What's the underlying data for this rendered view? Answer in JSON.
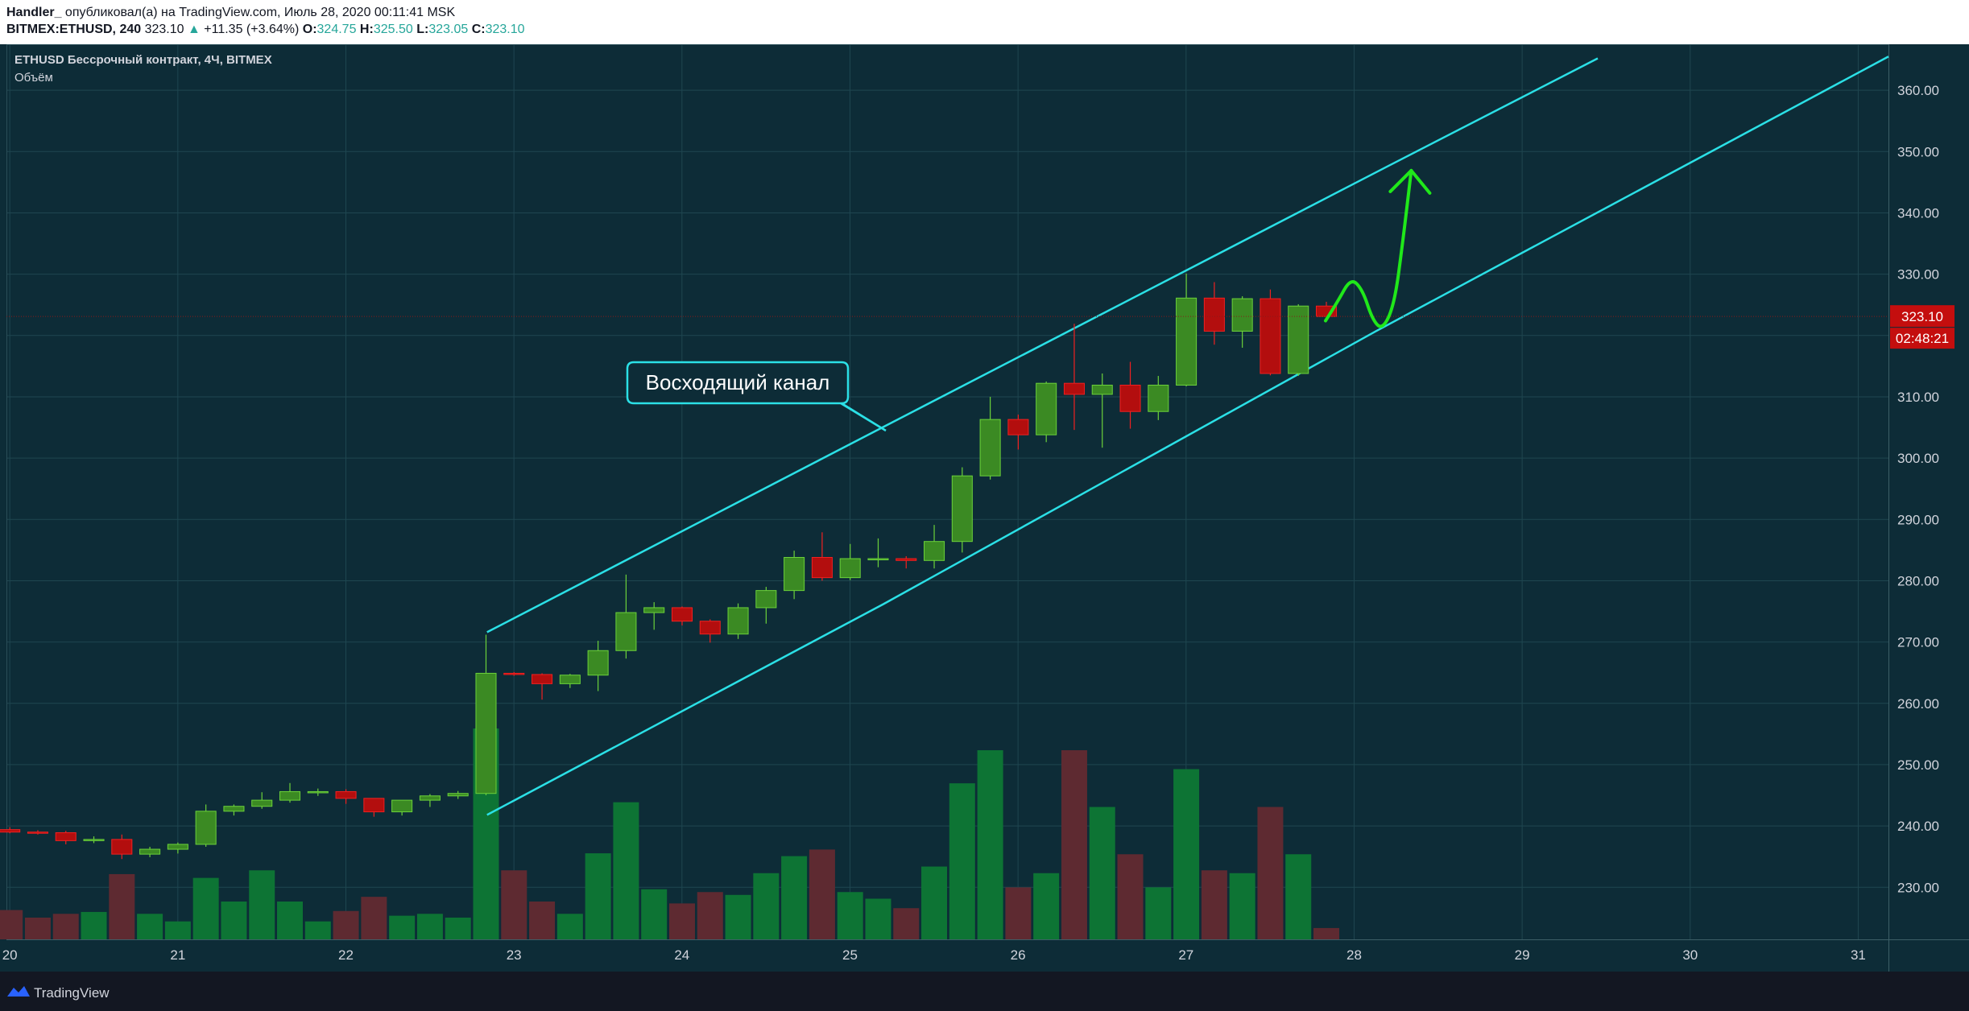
{
  "header": {
    "author": "Handler_",
    "published_text": "опубликовал(а) на TradingView.com, Июль 28, 2020 00:11:41 MSK",
    "symbol": "BITMEX:ETHUSD, 240",
    "last": "323.10",
    "change": "+11.35 (+3.64%)",
    "o_label": "O:",
    "o_value": "324.75",
    "h_label": "H:",
    "h_value": "325.50",
    "l_label": "L:",
    "l_value": "323.05",
    "c_label": "C:",
    "c_value": "323.10"
  },
  "legend": {
    "title": "ETHUSD Бессрочный контракт, 4Ч, BITMEX",
    "volume_label": "Объём"
  },
  "footer": {
    "brand": "TradingView"
  },
  "colors": {
    "up": "#3b8a23",
    "up_border": "#6bd13a",
    "down": "#b30e0e",
    "down_border": "#f02020",
    "vol_up": "#0d7434",
    "vol_down": "#5e2a31",
    "channel": "#2be0e6",
    "arrow": "#20e81a",
    "grid": "#1f4650",
    "price_tag": "#c40e0e"
  },
  "chart_data": {
    "type": "candlestick",
    "title": "ETHUSD Бессрочный контракт, 4Ч, BITMEX",
    "y_ticks": [
      230,
      240,
      250,
      260,
      270,
      280,
      290,
      300,
      310,
      320,
      330,
      340,
      350,
      360
    ],
    "y_tick_labels": [
      "230.00",
      "240.00",
      "250.00",
      "260.00",
      "270.00",
      "280.00",
      "290.00",
      "300.00",
      "310.00",
      "320.00",
      "330.00",
      "340.00",
      "350.00",
      "360.00"
    ],
    "ylim": [
      221.5,
      367.5
    ],
    "x_ticks": [
      20,
      21,
      22,
      23,
      24,
      25,
      26,
      27,
      28,
      29,
      30,
      31
    ],
    "x_tick_labels": [
      "20",
      "21",
      "22",
      "23",
      "24",
      "25",
      "26",
      "27",
      "28",
      "29",
      "30",
      "31"
    ],
    "xlim": [
      19.98,
      31.18
    ],
    "candle_start_day": 20.0,
    "candle_step_days": 0.1667,
    "candles": [
      [
        239.4,
        239.8,
        238.8,
        239.0
      ],
      [
        239.0,
        239.3,
        238.6,
        238.9
      ],
      [
        238.9,
        239.2,
        237.0,
        237.6
      ],
      [
        237.6,
        238.3,
        237.2,
        237.8
      ],
      [
        237.8,
        238.6,
        234.6,
        235.4
      ],
      [
        235.4,
        236.6,
        234.9,
        236.2
      ],
      [
        236.2,
        237.3,
        235.5,
        237.0
      ],
      [
        237.0,
        243.5,
        236.6,
        242.4
      ],
      [
        242.4,
        243.5,
        241.7,
        243.2
      ],
      [
        243.2,
        245.5,
        242.8,
        244.2
      ],
      [
        244.2,
        247.0,
        243.8,
        245.6
      ],
      [
        245.6,
        246.1,
        244.9,
        245.6
      ],
      [
        245.6,
        246.0,
        243.6,
        244.5
      ],
      [
        244.5,
        244.5,
        241.5,
        242.3
      ],
      [
        242.3,
        244.2,
        241.7,
        244.2
      ],
      [
        244.2,
        245.2,
        243.1,
        244.9
      ],
      [
        244.9,
        245.7,
        244.4,
        245.3
      ],
      [
        245.3,
        271.2,
        245.0,
        264.9
      ],
      [
        264.9,
        265.1,
        264.5,
        264.7
      ],
      [
        264.7,
        264.9,
        260.6,
        263.2
      ],
      [
        263.2,
        264.8,
        262.5,
        264.6
      ],
      [
        264.6,
        270.2,
        262.0,
        268.6
      ],
      [
        268.6,
        281.0,
        267.3,
        274.8
      ],
      [
        274.8,
        276.5,
        272.0,
        275.6
      ],
      [
        275.6,
        275.8,
        272.7,
        273.4
      ],
      [
        273.4,
        273.7,
        269.9,
        271.3
      ],
      [
        271.3,
        276.3,
        270.5,
        275.6
      ],
      [
        275.6,
        279.0,
        273.0,
        278.4
      ],
      [
        278.4,
        284.9,
        277.0,
        283.8
      ],
      [
        283.8,
        287.9,
        280.0,
        280.5
      ],
      [
        280.5,
        286.0,
        280.1,
        283.6
      ],
      [
        283.6,
        286.9,
        282.2,
        283.6
      ],
      [
        283.6,
        284.0,
        282.0,
        283.3
      ],
      [
        283.3,
        289.1,
        282.0,
        286.4
      ],
      [
        286.4,
        298.5,
        284.6,
        297.1
      ],
      [
        297.1,
        310.0,
        296.5,
        306.3
      ],
      [
        306.3,
        307.1,
        301.4,
        303.8
      ],
      [
        303.8,
        312.5,
        302.6,
        312.2
      ],
      [
        312.2,
        321.9,
        304.6,
        310.4
      ],
      [
        310.4,
        313.8,
        301.7,
        311.9
      ],
      [
        311.9,
        315.7,
        304.8,
        307.6
      ],
      [
        307.6,
        313.4,
        306.2,
        311.9
      ],
      [
        311.9,
        330.1,
        311.7,
        326.1
      ],
      [
        326.1,
        328.7,
        318.5,
        320.7
      ],
      [
        320.7,
        326.4,
        318.0,
        326.0
      ],
      [
        326.0,
        327.5,
        313.5,
        313.8
      ],
      [
        313.8,
        325.1,
        313.4,
        324.8
      ],
      [
        324.8,
        325.5,
        323.1,
        323.1
      ]
    ],
    "volumes": [
      31,
      23,
      27,
      29,
      69,
      27,
      19,
      65,
      40,
      73,
      40,
      19,
      30,
      45,
      25,
      27,
      23,
      223,
      73,
      40,
      27,
      91,
      145,
      53,
      38,
      50,
      47,
      70,
      88,
      95,
      50,
      43,
      33,
      77,
      165,
      200,
      55,
      70,
      200,
      140,
      90,
      55,
      180,
      73,
      70,
      140,
      90,
      12
    ],
    "channel_lines": [
      {
        "name": "Upper channel line",
        "points": [
          [
            22.84,
            271.6
          ],
          [
            25.2,
            305.1
          ],
          [
            28.2,
            347.6
          ],
          [
            29.45,
            365.2
          ]
        ]
      },
      {
        "name": "Lower channel line",
        "points": [
          [
            22.84,
            241.8
          ],
          [
            25.2,
            276.2
          ],
          [
            28.13,
            320.7
          ],
          [
            31.18,
            365.5
          ]
        ]
      }
    ],
    "annotation": {
      "text": "Восходящий канал"
    },
    "last_price": "323.10",
    "countdown": "02:48:21",
    "projection": [
      [
        27.83,
        322.4
      ],
      [
        27.9,
        325.4
      ],
      [
        27.98,
        329.4
      ],
      [
        28.05,
        327.5
      ],
      [
        28.11,
        322.5
      ],
      [
        28.17,
        320.9
      ],
      [
        28.24,
        325.1
      ],
      [
        28.29,
        335.3
      ],
      [
        28.34,
        346.9
      ]
    ]
  }
}
